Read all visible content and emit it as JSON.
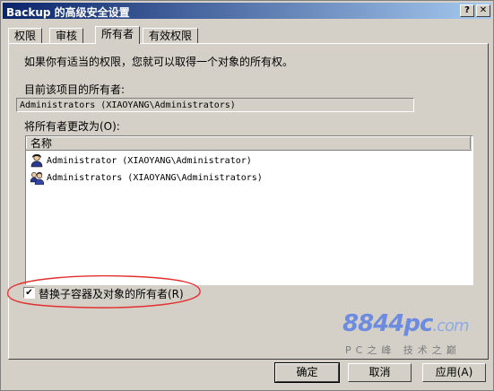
{
  "window": {
    "title": "Backup 的高级安全设置",
    "help_glyph": "?",
    "close_glyph": "✕"
  },
  "tabs": [
    {
      "label": "权限"
    },
    {
      "label": "审核"
    },
    {
      "label": "所有者"
    },
    {
      "label": "有效权限"
    }
  ],
  "active_tab": "所有者",
  "owner_page": {
    "intro": "如果你有适当的权限，您就可以取得一个对象的所有权。",
    "current_owner_label": "目前该项目的所有者:",
    "current_owner_value": "Administrators (XIAOYANG\\Administrators)",
    "change_to_label": "将所有者更改为(O):",
    "list_header": "名称",
    "list_items": [
      {
        "label": "Administrator (XIAOYANG\\Administrator)",
        "icon": "single-user-icon"
      },
      {
        "label": "Administrators (XIAOYANG\\Administrators)",
        "icon": "user-group-icon"
      }
    ],
    "replace_checkbox": {
      "label": "替换子容器及对象的所有者(R)",
      "checked": true,
      "mark": "✔"
    }
  },
  "watermark": {
    "logo_main": "8844pc",
    "logo_suffix": ".com",
    "slogan": "PC之峰 技术之巅"
  },
  "buttons": {
    "ok": "确定",
    "cancel": "取消",
    "apply": "应用(A)"
  },
  "colors": {
    "titlebar_start": "#0a246a",
    "titlebar_end": "#a6caf0",
    "highlight_ellipse": "#e23030",
    "watermark_blue": "#6d8ce0"
  }
}
